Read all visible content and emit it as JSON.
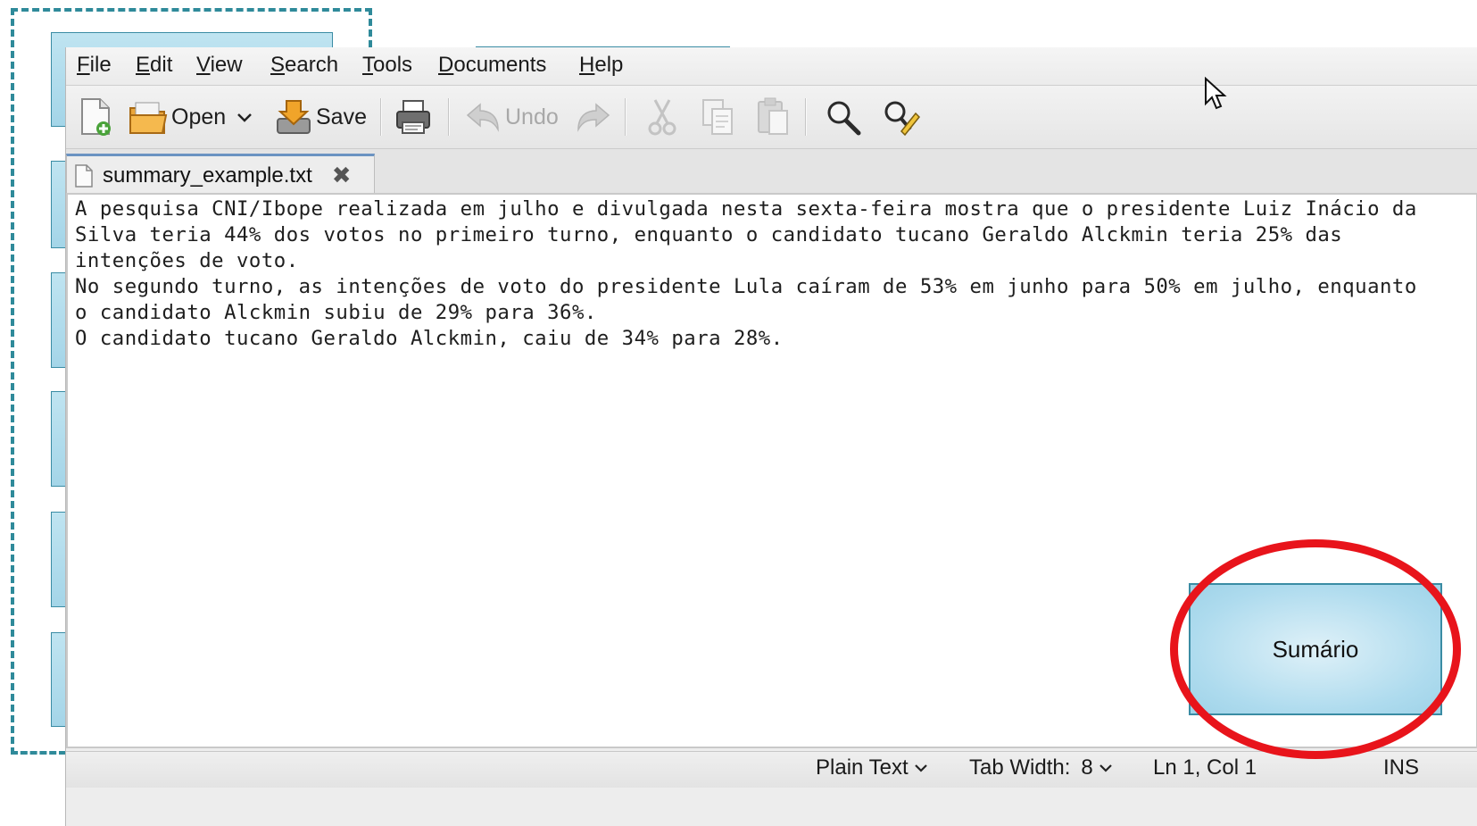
{
  "menubar": {
    "items": [
      {
        "label": "File",
        "underline": "F",
        "rest": "ile"
      },
      {
        "label": "Edit",
        "underline": "E",
        "rest": "dit"
      },
      {
        "label": "View",
        "underline": "V",
        "rest": "iew"
      },
      {
        "label": "Search",
        "underline": "S",
        "rest": "earch"
      },
      {
        "label": "Tools",
        "underline": "T",
        "rest": "ools"
      },
      {
        "label": "Documents",
        "underline": "D",
        "rest": "ocuments"
      },
      {
        "label": "Help",
        "underline": "H",
        "rest": "elp"
      }
    ]
  },
  "toolbar": {
    "open_label": "Open",
    "save_label": "Save",
    "undo_label": "Undo",
    "icons": [
      "new-document-icon",
      "open-folder-icon",
      "save-icon",
      "print-icon",
      "undo-icon",
      "redo-icon",
      "cut-icon",
      "copy-icon",
      "paste-icon",
      "search-icon",
      "search-replace-icon"
    ]
  },
  "tab": {
    "filename": "summary_example.txt",
    "close_glyph": "✖"
  },
  "editor": {
    "lines": [
      "A pesquisa CNI/Ibope realizada em julho e divulgada nesta sexta-feira mostra que o presidente Luiz Inácio da",
      "Silva teria 44% dos votos no primeiro turno, enquanto o candidato tucano Geraldo Alckmin teria 25% das",
      "intenções de voto.",
      "No segundo turno, as intenções de voto do presidente Lula caíram de 53% em junho para 50% em julho, enquanto",
      "o candidato Alckmin subiu de 29% para 36%.",
      "O candidato tucano Geraldo Alckmin, caiu de 34% para 28%."
    ]
  },
  "statusbar": {
    "syntax": "Plain Text",
    "tab_width_label": "Tab Width:",
    "tab_width_value": "8",
    "position": "Ln 1, Col 1",
    "mode": "INS"
  },
  "annotation": {
    "label": "Sumário",
    "highlight_color": "#e8141b"
  },
  "colors": {
    "accent_frame": "#2f8a9a",
    "box_fill": "#a4d5e8"
  }
}
